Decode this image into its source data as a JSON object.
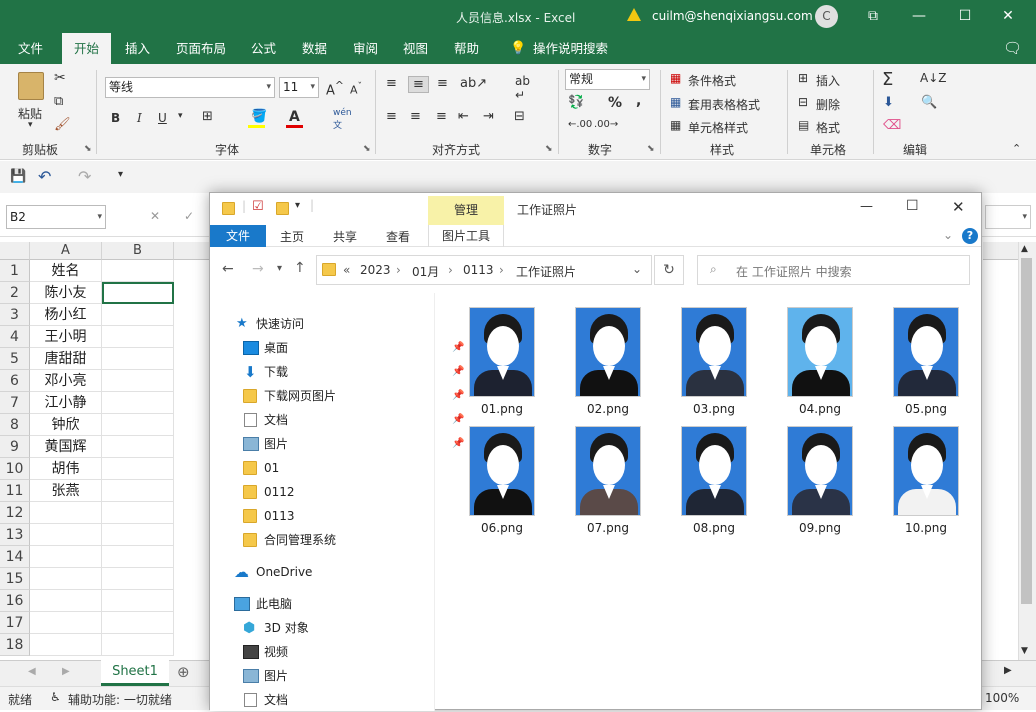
{
  "excel": {
    "title": "人员信息.xlsx  -  Excel",
    "user": "cuilm@shenqixiangsu.com",
    "avatar_letter": "C",
    "tabs": [
      "文件",
      "开始",
      "插入",
      "页面布局",
      "公式",
      "数据",
      "审阅",
      "视图",
      "帮助",
      "操作说明搜索"
    ],
    "active_tab": "开始",
    "ribbon": {
      "clipboard": {
        "paste": "粘贴",
        "label": "剪贴板"
      },
      "font": {
        "name": "等线",
        "size": "11",
        "label": "字体",
        "bold": "B",
        "italic": "I",
        "underline": "U"
      },
      "alignment": {
        "label": "对齐方式"
      },
      "number": {
        "format": "常规",
        "label": "数字",
        "percent": "%",
        "comma": ","
      },
      "styles": {
        "conditional": "条件格式",
        "table": "套用表格格式",
        "cell": "单元格样式",
        "label": "样式"
      },
      "cells": {
        "insert": "插入",
        "delete": "删除",
        "format": "格式",
        "label": "单元格"
      },
      "editing": {
        "label": "编辑"
      }
    },
    "name_box": "B2",
    "columns": [
      "A",
      "B"
    ],
    "rows": [
      "1",
      "2",
      "3",
      "4",
      "5",
      "6",
      "7",
      "8",
      "9",
      "10",
      "11",
      "12",
      "13",
      "14",
      "15",
      "16",
      "17",
      "18"
    ],
    "colA": [
      "姓名",
      "陈小友",
      "杨小红",
      "王小明",
      "唐甜甜",
      "邓小亮",
      "江小静",
      "钟欣",
      "黄国辉",
      "胡伟",
      "张燕",
      "",
      "",
      "",
      "",
      "",
      "",
      ""
    ],
    "sheet_tab": "Sheet1",
    "status": {
      "ready": "就绪",
      "accessibility": "辅助功能: 一切就绪",
      "zoom": "100%"
    }
  },
  "explorer": {
    "context_tab": "管理",
    "window_title": "工作证照片",
    "tabs": [
      "文件",
      "主页",
      "共享",
      "查看",
      "图片工具"
    ],
    "breadcrumb": [
      "«",
      "2023",
      "01月",
      "0113",
      "工作证照片"
    ],
    "search_placeholder": "在 工作证照片 中搜索",
    "nav": {
      "quick_access": "快速访问",
      "pinned": [
        "桌面",
        "下载",
        "下载网页图片",
        "文档",
        "图片"
      ],
      "folders": [
        "01",
        "0112",
        "0113",
        "合同管理系统"
      ],
      "onedrive": "OneDrive",
      "this_pc": "此电脑",
      "pc_items": [
        "3D 对象",
        "视频",
        "图片",
        "文档"
      ]
    },
    "files": [
      "01.png",
      "02.png",
      "03.png",
      "04.png",
      "05.png",
      "06.png",
      "07.png",
      "08.png",
      "09.png",
      "10.png"
    ],
    "photo_bg": [
      "#2f7bd6",
      "#2f7bd6",
      "#2f7bd6",
      "#5fb3ec",
      "#2f7bd6",
      "#2f7bd6",
      "#2f7bd6",
      "#2f7bd6",
      "#2f7bd6",
      "#2f7bd6"
    ]
  }
}
